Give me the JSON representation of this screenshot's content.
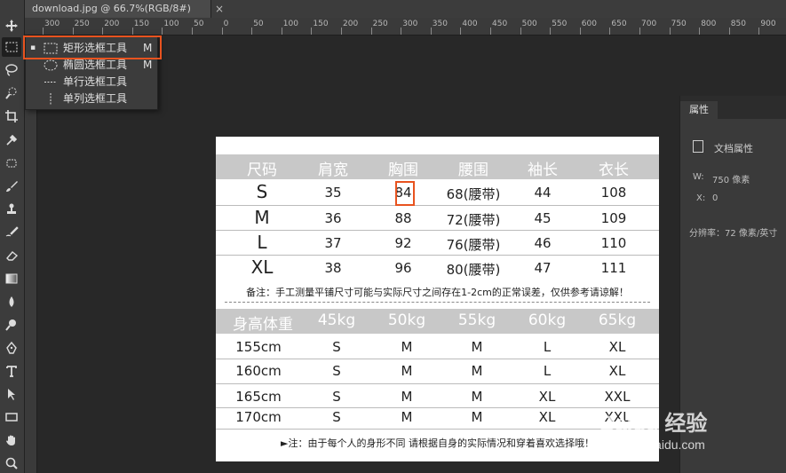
{
  "document_tab": {
    "title": "download.jpg @ 66.7%(RGB/8#)",
    "close": "×"
  },
  "ruler": {
    "labels": [
      "300",
      "250",
      "200",
      "150",
      "100",
      "50",
      "0",
      "50",
      "100",
      "150",
      "200",
      "250",
      "300",
      "350",
      "400",
      "450",
      "500",
      "550",
      "600",
      "650",
      "700",
      "750",
      "800",
      "850",
      "900"
    ]
  },
  "flyout": {
    "items": [
      {
        "label": "矩形选框工具",
        "key": "M",
        "selected": true,
        "icon": "rect-marquee-icon"
      },
      {
        "label": "椭圆选框工具",
        "key": "M",
        "selected": false,
        "icon": "ellipse-marquee-icon"
      },
      {
        "label": "单行选框工具",
        "key": "",
        "selected": false,
        "icon": "single-row-marquee-icon"
      },
      {
        "label": "单列选框工具",
        "key": "",
        "selected": false,
        "icon": "single-column-marquee-icon"
      }
    ],
    "bullet": "▪"
  },
  "properties_panel": {
    "tab": "属性",
    "doc_label": "文档属性",
    "width_label": "W:",
    "width_value": "750 像素",
    "x_label": "X:",
    "x_value": "0",
    "resolution": "分辨率：72 像素/英寸"
  },
  "size_chart": {
    "header": [
      "尺码",
      "肩宽",
      "胸围",
      "腰围",
      "袖长",
      "衣长"
    ],
    "rows": [
      [
        "S",
        "35",
        "84",
        "68(腰带)",
        "44",
        "108"
      ],
      [
        "M",
        "36",
        "88",
        "72(腰带)",
        "45",
        "109"
      ],
      [
        "L",
        "37",
        "92",
        "76(腰带)",
        "46",
        "110"
      ],
      [
        "XL",
        "38",
        "96",
        "80(腰带)",
        "47",
        "111"
      ]
    ],
    "note": "备注：手工测量平铺尺寸可能与实际尺寸之间存在1-2cm的正常误差，仅供参考请谅解！"
  },
  "fit_chart": {
    "header": [
      "身高体重",
      "45kg",
      "50kg",
      "55kg",
      "60kg",
      "65kg"
    ],
    "rows": [
      [
        "155cm",
        "S",
        "M",
        "M",
        "L",
        "XL"
      ],
      [
        "160cm",
        "S",
        "M",
        "M",
        "L",
        "XL"
      ],
      [
        "165cm",
        "S",
        "M",
        "M",
        "XL",
        "XXL"
      ],
      [
        "170cm",
        "S",
        "M",
        "M",
        "XL",
        "XXL"
      ]
    ],
    "note": "►注：由于每个人的身形不同 请根据自身的实际情况和穿着喜欢选择哦！"
  },
  "watermark": {
    "main": "Baidu 经验",
    "sub": "jingyan.baidu.com"
  },
  "colors": {
    "highlight": "#e8531f",
    "band": "#c8c8c8",
    "background": "#282828"
  }
}
